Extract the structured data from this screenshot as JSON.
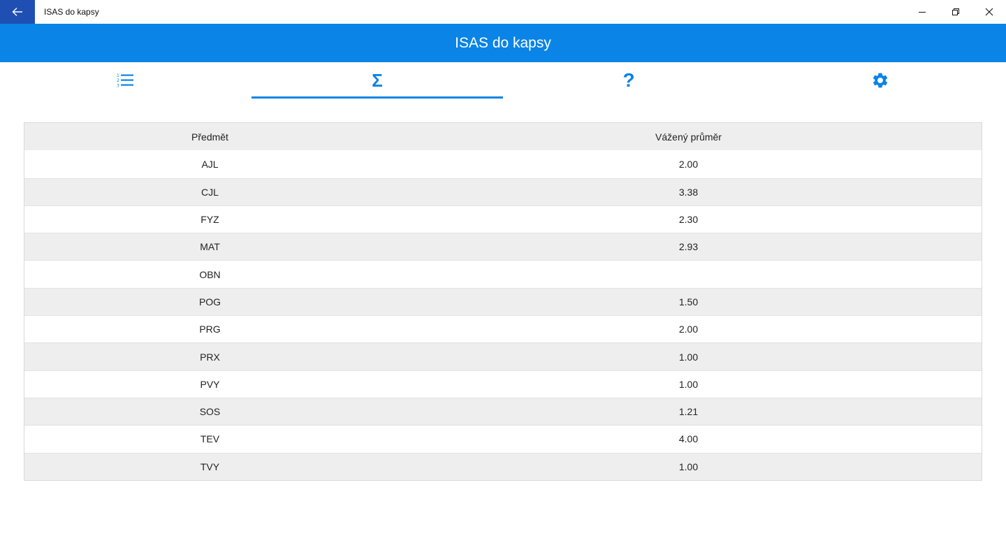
{
  "window": {
    "title": "ISAS do kapsy"
  },
  "header": {
    "title": "ISAS do kapsy"
  },
  "tabs": [
    {
      "icon": "numbered-list-icon",
      "active": false
    },
    {
      "icon": "sigma-icon",
      "active": true
    },
    {
      "icon": "help-icon",
      "active": false
    },
    {
      "icon": "gear-icon",
      "active": false
    }
  ],
  "table": {
    "columns": [
      "Předmět",
      "Vážený průměr"
    ],
    "rows": [
      {
        "subject": "AJL",
        "avg": "2.00"
      },
      {
        "subject": "CJL",
        "avg": "3.38"
      },
      {
        "subject": "FYZ",
        "avg": "2.30"
      },
      {
        "subject": "MAT",
        "avg": "2.93"
      },
      {
        "subject": "OBN",
        "avg": ""
      },
      {
        "subject": "POG",
        "avg": "1.50"
      },
      {
        "subject": "PRG",
        "avg": "2.00"
      },
      {
        "subject": "PRX",
        "avg": "1.00"
      },
      {
        "subject": "PVY",
        "avg": "1.00"
      },
      {
        "subject": "SOS",
        "avg": "1.21"
      },
      {
        "subject": "TEV",
        "avg": "4.00"
      },
      {
        "subject": "TVY",
        "avg": "1.00"
      }
    ]
  },
  "colors": {
    "accent": "#0a84e6",
    "back_button": "#1f4fb3",
    "row_alt": "#eeeeee"
  }
}
